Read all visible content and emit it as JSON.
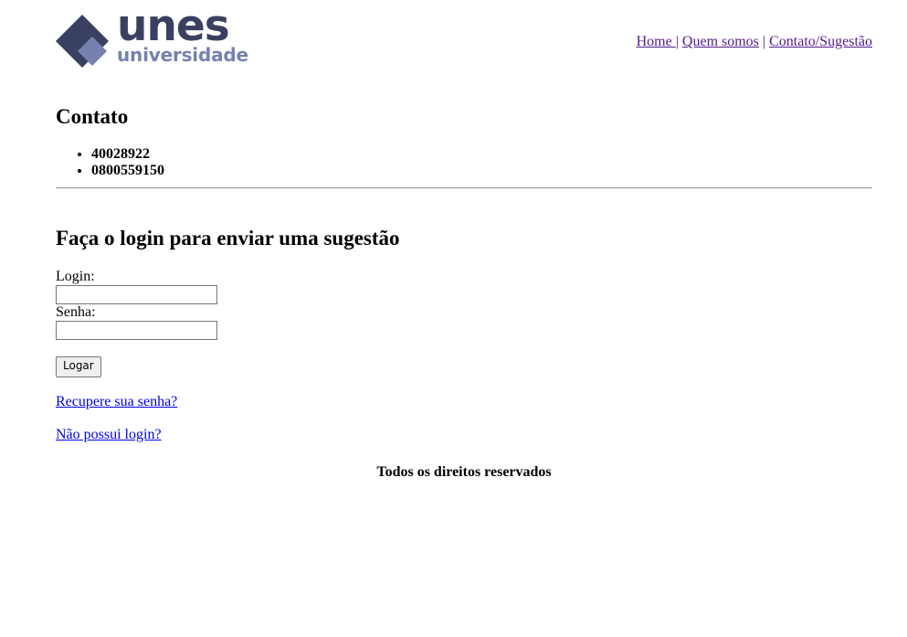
{
  "header": {
    "logo": {
      "main_text": "unes",
      "sub_text": "universidade",
      "main_color": "#3a4160",
      "sub_color": "#7781b0"
    },
    "nav": {
      "items": [
        {
          "label": "Home "
        },
        {
          "label": "Quem somos"
        },
        {
          "label": "Contato/Sugestão"
        }
      ],
      "separator": "|",
      "visited_color": "#551a8b"
    }
  },
  "contato": {
    "title": "Contato",
    "phones": [
      "40028922",
      "0800559150"
    ]
  },
  "login": {
    "title": "Faça o login para enviar uma sugestão",
    "login_label": "Login:",
    "login_value": "",
    "password_label": "Senha:",
    "password_value": "",
    "submit_label": "Logar",
    "recover_link": "Recupere sua senha?",
    "signup_link": "Não possui login?",
    "link_color": "#0000ee"
  },
  "footer": {
    "text": "Todos os direitos reservados"
  }
}
